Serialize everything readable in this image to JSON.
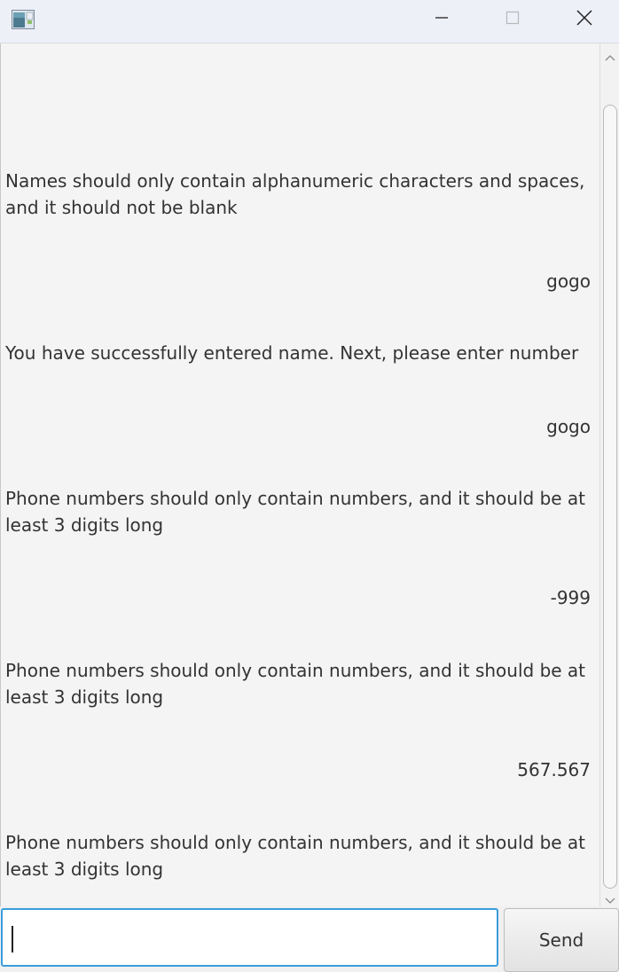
{
  "window": {
    "icon": "app-window-icon",
    "controls": [
      "minimize-icon",
      "maximize-icon",
      "close-icon"
    ]
  },
  "chat": {
    "messages": [
      {
        "sender": "bot",
        "text": "Names should only contain alphanumeric characters and spaces, and it should not be blank"
      },
      {
        "sender": "user",
        "text": "gogo"
      },
      {
        "sender": "bot",
        "text": "You have successfully entered name. Next, please enter number"
      },
      {
        "sender": "user",
        "text": "gogo"
      },
      {
        "sender": "bot",
        "text": "Phone numbers should only contain numbers, and it should be at least 3 digits long"
      },
      {
        "sender": "user",
        "text": "-999"
      },
      {
        "sender": "bot",
        "text": "Phone numbers should only contain numbers, and it should be at least 3 digits long"
      },
      {
        "sender": "user",
        "text": "567.567"
      },
      {
        "sender": "bot",
        "text": "Phone numbers should only contain numbers, and it should be at least 3 digits long"
      }
    ]
  },
  "input": {
    "value": "",
    "placeholder": ""
  },
  "send_button": {
    "label": "Send"
  },
  "colors": {
    "titlebar": "#eef0f8",
    "chat_background": "#f4f4f4",
    "input_focus_border": "#3a9ddb"
  }
}
